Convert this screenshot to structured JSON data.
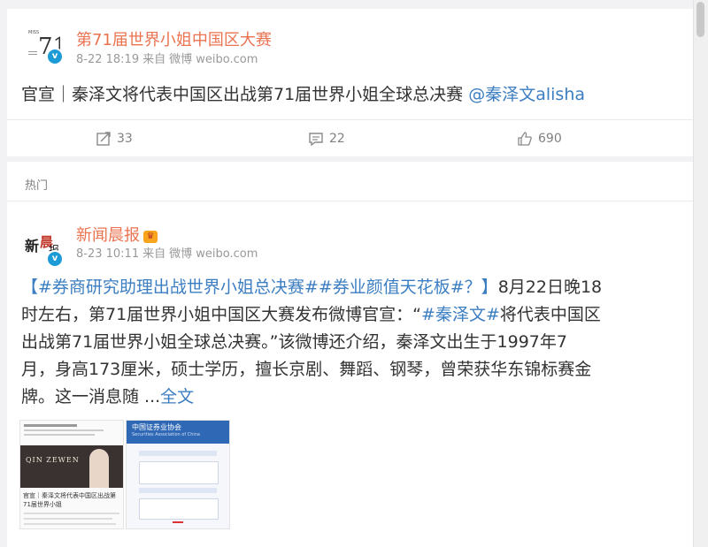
{
  "post1": {
    "author": "第71届世界小姐中国区大赛",
    "date": "8-22 18:19",
    "from_label": "来自",
    "source": "微博 weibo.com",
    "text_plain": "官宣｜秦泽文将代表中国区出战第71届世界小姐全球总决赛 ",
    "mention": "@秦泽文alisha",
    "reposts": "33",
    "comments": "22",
    "likes": "690"
  },
  "section_label": "热门",
  "post2": {
    "author": "新闻晨报",
    "date": "8-23 10:11",
    "from_label": "来自",
    "source": "微博 weibo.com",
    "hashtags": "【#券商研究助理出战世界小姐总决赛##券业颜值天花板#？】",
    "line1_rest": "8月22日晚18",
    "line2_start": "时左右，第71届世界小姐中国区大赛发布微博官宣：“",
    "line2_tag": "#秦泽文#",
    "line2_end": "将代表中国区",
    "line3": "出战第71届世界小姐全球总决赛。”该微博还介绍，秦泽文出生于1997年7",
    "line4": "月，身高173厘米，硕士学历，擅长京剧、舞蹈、钢琴，曾荣获华东锦标赛金",
    "line5_start": "牌。这一消息随 ...",
    "full_text_link": "全文"
  },
  "thumb1": {
    "banner_text": "QIN ZEWEN",
    "caption": "官宣｜秦泽文将代表中国区出战第71届世界小姐"
  },
  "thumb2": {
    "header": "中国证券业协会",
    "header_en": "Securities Association of China"
  },
  "colors": {
    "accent_orange": "#eb7350",
    "link_blue": "#3c7ec2",
    "verified_blue": "#1d9bd7"
  },
  "icons": {
    "repost": "repost-icon",
    "comment": "comment-icon",
    "like": "like-icon",
    "verified": "verified-badge-icon",
    "crown": "vip-crown-icon"
  }
}
